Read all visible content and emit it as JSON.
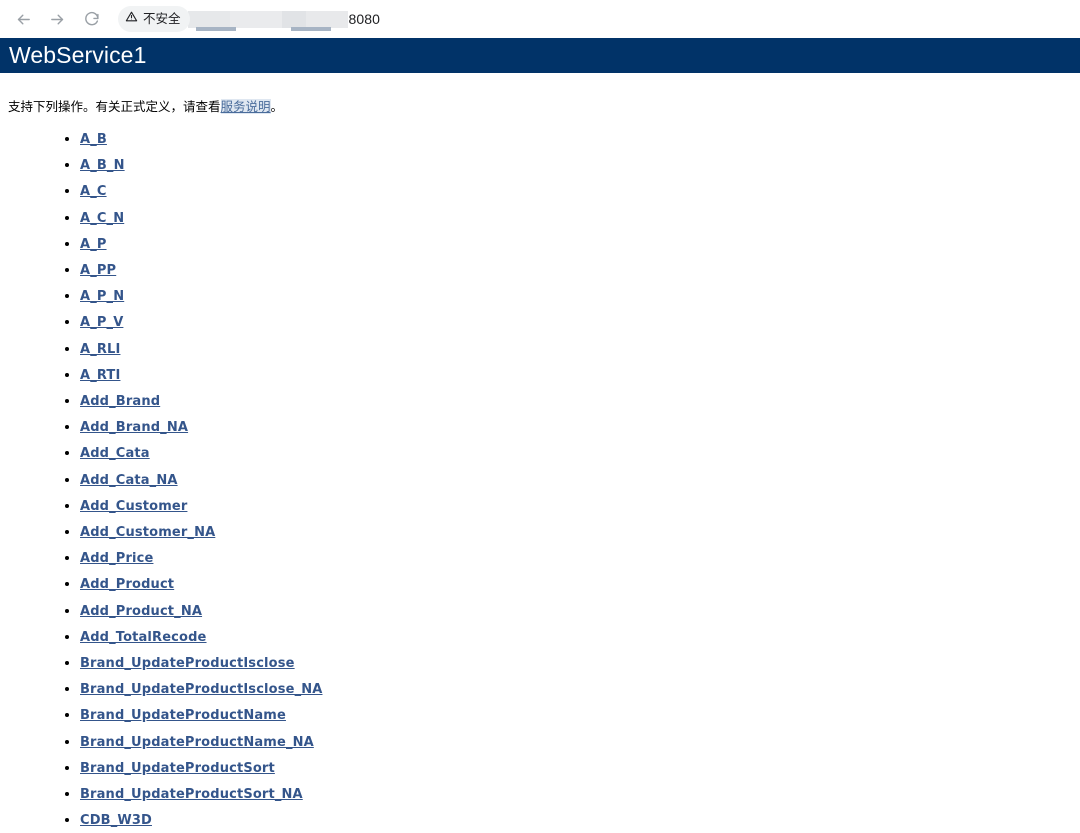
{
  "browser": {
    "back_icon": "back-arrow-icon",
    "forward_icon": "forward-arrow-icon",
    "reload_icon": "reload-icon",
    "security_icon": "warning-triangle-icon",
    "security_label": "不安全",
    "url_visible_tail": "8080",
    "url_placeholder": "搜索或输入网址",
    "url_redacted": true
  },
  "header": {
    "title": "WebService1",
    "bar_color": "#013368",
    "title_color": "#ffffff"
  },
  "intro": {
    "text_before": "支持下列操作。有关正式定义，请查看",
    "link_text": "服务说明",
    "text_after": "。"
  },
  "operations": {
    "link_color": "#34558b",
    "items": [
      "A_B",
      "A_B_N",
      "A_C",
      "A_C_N",
      "A_P",
      "A_PP",
      "A_P_N",
      "A_P_V",
      "A_RLI",
      "A_RTI",
      "Add_Brand",
      "Add_Brand_NA",
      "Add_Cata",
      "Add_Cata_NA",
      "Add_Customer",
      "Add_Customer_NA",
      "Add_Price",
      "Add_Product",
      "Add_Product_NA",
      "Add_TotalRecode",
      "Brand_UpdateProductIsclose",
      "Brand_UpdateProductIsclose_NA",
      "Brand_UpdateProductName",
      "Brand_UpdateProductName_NA",
      "Brand_UpdateProductSort",
      "Brand_UpdateProductSort_NA",
      "CDB_W3D"
    ]
  }
}
